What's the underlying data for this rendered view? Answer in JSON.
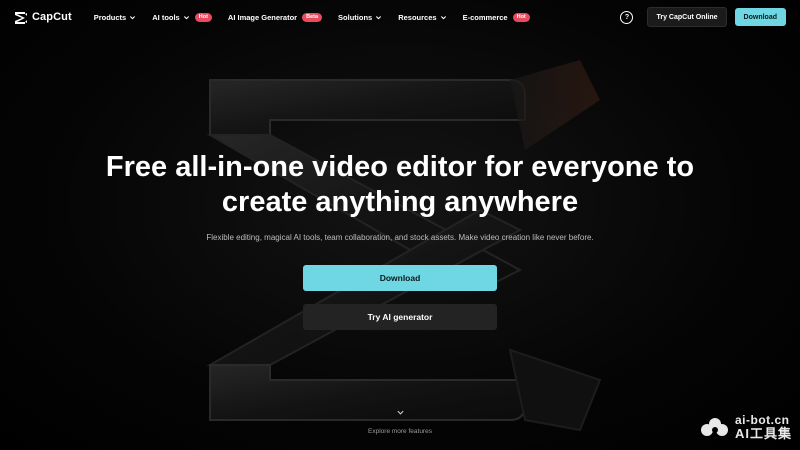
{
  "brand": {
    "name": "CapCut"
  },
  "nav": {
    "items": [
      {
        "label": "Products",
        "has_dropdown": true,
        "badge": ""
      },
      {
        "label": "AI tools",
        "has_dropdown": true,
        "badge": "Hot"
      },
      {
        "label": "AI Image Generator",
        "has_dropdown": false,
        "badge": "Beta"
      },
      {
        "label": "Solutions",
        "has_dropdown": true,
        "badge": ""
      },
      {
        "label": "Resources",
        "has_dropdown": true,
        "badge": ""
      },
      {
        "label": "E-commerce",
        "has_dropdown": false,
        "badge": "Hot"
      }
    ]
  },
  "header_actions": {
    "help_glyph": "?",
    "try_online_label": "Try CapCut Online",
    "download_label": "Download"
  },
  "hero": {
    "title_line1": "Free all-in-one video editor for everyone to",
    "title_line2": "create anything anywhere",
    "subtitle": "Flexible editing, magical AI tools, team collaboration, and stock assets. Make video creation like never before.",
    "primary_cta": "Download",
    "secondary_cta": "Try AI generator"
  },
  "explore": {
    "label": "Explore more features"
  },
  "watermark": {
    "line1": "ai-bot.cn",
    "line2": "AI工具集"
  },
  "colors": {
    "accent": "#6fd6e3",
    "hot_badge": "#e84a5f",
    "beta_badge": "#e84a5f",
    "background": "#000000",
    "secondary_button": "#232323"
  },
  "icons": {
    "logo": "capcut-logo-icon",
    "chevron": "chevron-down-icon",
    "help": "help-circle-icon",
    "explore": "chevron-down-icon"
  }
}
